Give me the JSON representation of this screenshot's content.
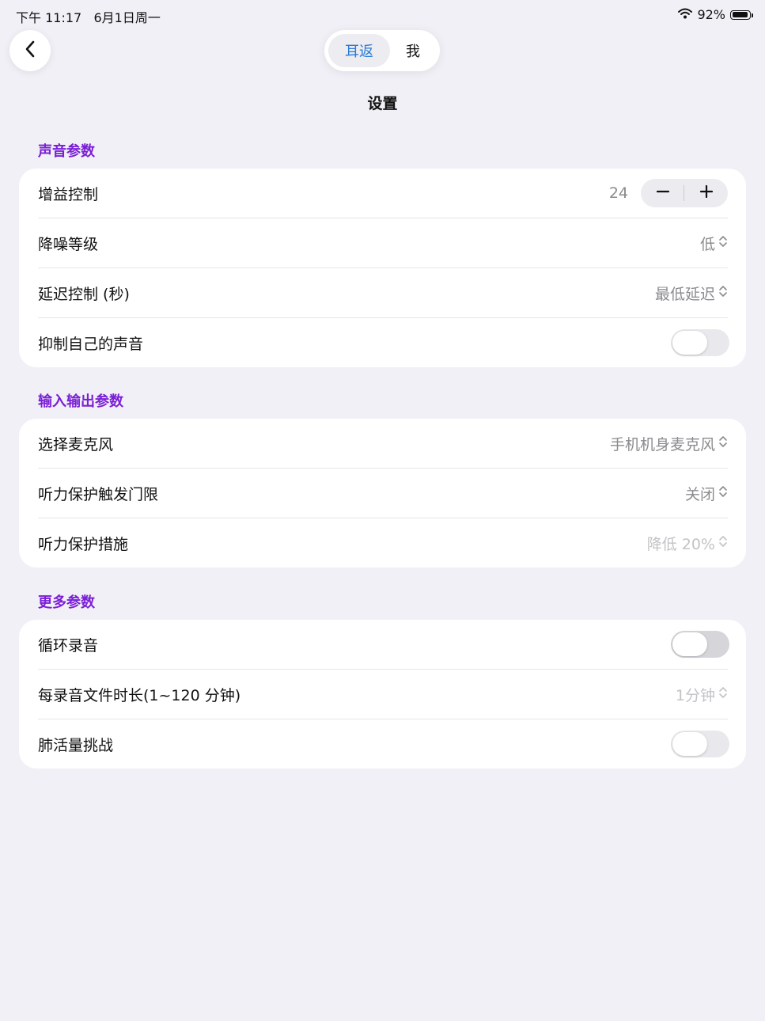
{
  "status_bar": {
    "time": "下午 11:17",
    "date": "6月1日周一",
    "battery_percent": "92%",
    "battery_level": 0.92,
    "icons": [
      "wifi-icon",
      "battery-icon"
    ]
  },
  "nav": {
    "back_icon": "chevron-left-icon",
    "tabs": [
      {
        "label": "耳返",
        "active": true
      },
      {
        "label": "我",
        "active": false
      }
    ],
    "title": "设置"
  },
  "colors": {
    "accent": "#2a7bd6",
    "section": "#7a1fd6",
    "background": "#f1f0f6"
  },
  "sections": [
    {
      "title": "声音参数",
      "rows": [
        {
          "label": "增益控制",
          "type": "stepper",
          "value": "24"
        },
        {
          "label": "降噪等级",
          "type": "select",
          "value": "低"
        },
        {
          "label": "延迟控制 (秒)",
          "type": "select",
          "value": "最低延迟"
        },
        {
          "label": "抑制自己的声音",
          "type": "toggle",
          "on": false
        }
      ]
    },
    {
      "title": "输入输出参数",
      "rows": [
        {
          "label": "选择麦克风",
          "type": "select",
          "value": "手机机身麦克风"
        },
        {
          "label": "听力保护触发门限",
          "type": "select",
          "value": "关闭"
        },
        {
          "label": "听力保护措施",
          "type": "select",
          "value": "降低 20%",
          "disabled": true
        }
      ]
    },
    {
      "title": "更多参数",
      "rows": [
        {
          "label": "循环录音",
          "type": "toggle",
          "on": false
        },
        {
          "label": "每录音文件时长(1~120 分钟)",
          "type": "select",
          "value": "1分钟",
          "disabled": true
        },
        {
          "label": "肺活量挑战",
          "type": "toggle",
          "on": false
        }
      ]
    }
  ]
}
